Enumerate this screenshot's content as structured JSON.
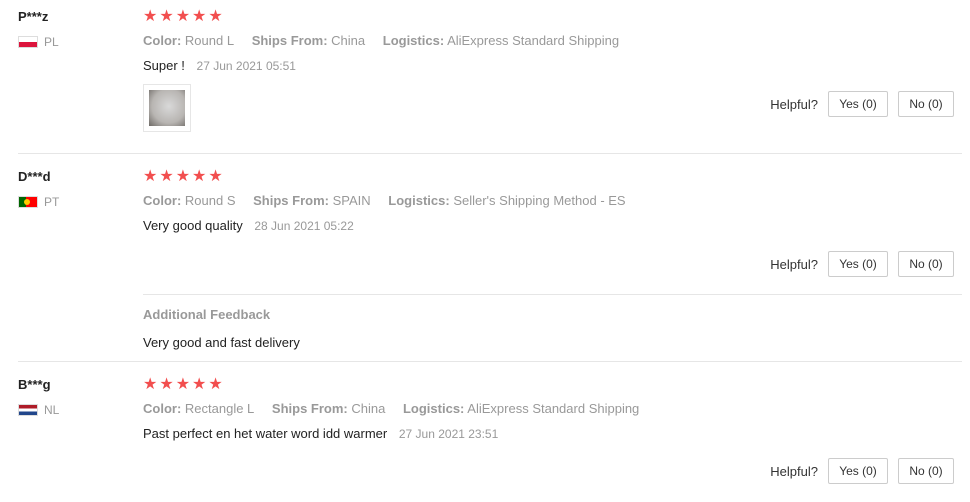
{
  "reviews": [
    {
      "user": "P***z",
      "country": "PL",
      "stars": 5,
      "color_label": "Color:",
      "color_value": "Round L",
      "ships_label": "Ships From:",
      "ships_value": "China",
      "logistics_label": "Logistics:",
      "logistics_value": "AliExpress Standard Shipping",
      "text": "Super !",
      "date": "27 Jun 2021 05:51",
      "helpful_label": "Helpful?",
      "yes_label": "Yes (0)",
      "no_label": "No (0)"
    },
    {
      "user": "D***d",
      "country": "PT",
      "stars": 5,
      "color_label": "Color:",
      "color_value": "Round S",
      "ships_label": "Ships From:",
      "ships_value": "SPAIN",
      "logistics_label": "Logistics:",
      "logistics_value": "Seller's Shipping Method - ES",
      "text": "Very good quality",
      "date": "28 Jun 2021 05:22",
      "helpful_label": "Helpful?",
      "yes_label": "Yes (0)",
      "no_label": "No (0)",
      "additional_title": "Additional Feedback",
      "additional_text": "Very good and fast delivery"
    },
    {
      "user": "B***g",
      "country": "NL",
      "stars": 5,
      "color_label": "Color:",
      "color_value": "Rectangle L",
      "ships_label": "Ships From:",
      "ships_value": "China",
      "logistics_label": "Logistics:",
      "logistics_value": "AliExpress Standard Shipping",
      "text": "Past perfect en het water word idd warmer",
      "date": "27 Jun 2021 23:51",
      "helpful_label": "Helpful?",
      "yes_label": "Yes (0)",
      "no_label": "No (0)"
    }
  ],
  "colors": {
    "star": "#f24e4e",
    "muted_text": "#999999",
    "divider": "#e6e6e6",
    "button_border": "#cccccc"
  }
}
